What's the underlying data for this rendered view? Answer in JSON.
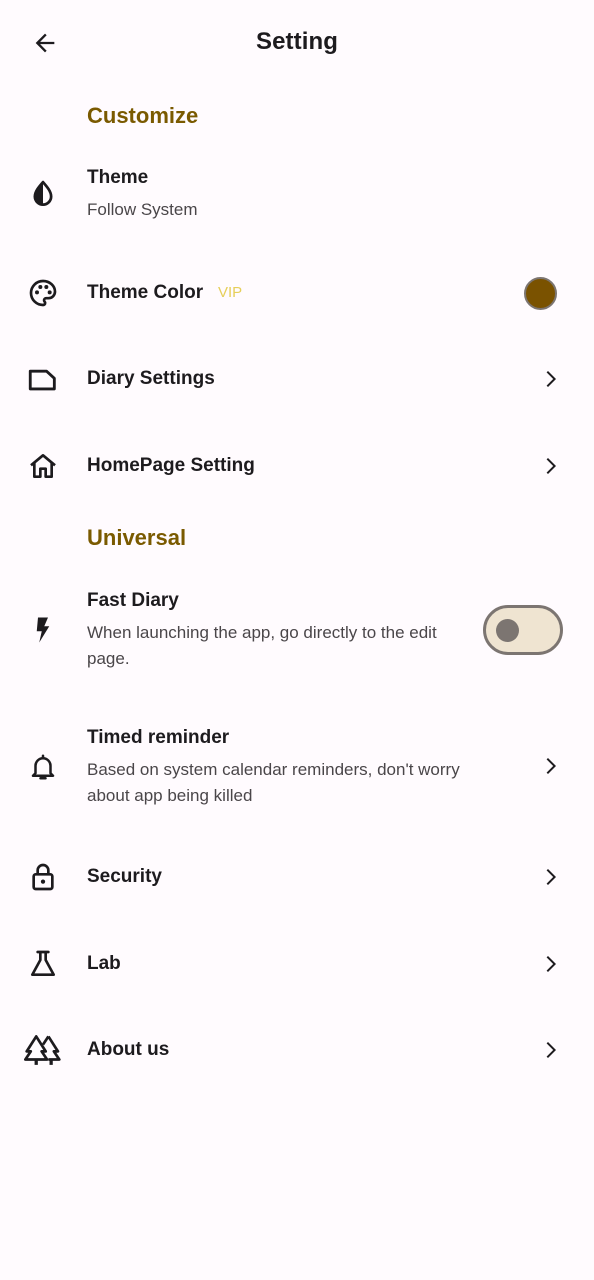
{
  "header": {
    "title": "Setting",
    "back_icon": "arrow-back-icon"
  },
  "sections": {
    "customize": "Customize",
    "universal": "Universal"
  },
  "items": {
    "theme": {
      "title": "Theme",
      "subtitle": "Follow System",
      "icon": "contrast-drop-icon"
    },
    "theme_color": {
      "title": "Theme Color",
      "badge": "VIP",
      "icon": "palette-icon",
      "color": "#7a5200"
    },
    "diary_settings": {
      "title": "Diary Settings",
      "icon": "label-outline-icon"
    },
    "homepage_setting": {
      "title": "HomePage Setting",
      "icon": "home-icon"
    },
    "fast_diary": {
      "title": "Fast Diary",
      "subtitle_line1": "When launching the app, go directly to the edit",
      "subtitle_line2": "page.",
      "icon": "flash-icon",
      "enabled": false
    },
    "timed_reminder": {
      "title": "Timed reminder",
      "subtitle_line1": "Based on system calendar reminders, don't worry",
      "subtitle_line2": "about app being killed",
      "icon": "bell-icon"
    },
    "security": {
      "title": "Security",
      "icon": "lock-icon"
    },
    "lab": {
      "title": "Lab",
      "icon": "flask-icon"
    },
    "about_us": {
      "title": "About us",
      "icon": "forest-icon"
    }
  },
  "colors": {
    "accent": "#7a5a00",
    "background": "#fffbfe",
    "vip": "#e6cf5a"
  }
}
